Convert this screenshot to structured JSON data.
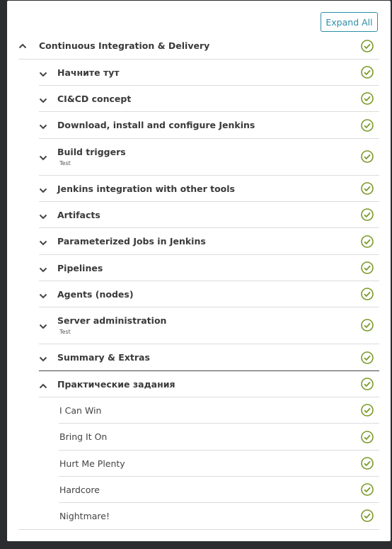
{
  "toolbar": {
    "expand_all_label": "Expand All"
  },
  "course": {
    "title": "Continuous Integration & Delivery",
    "sections": [
      {
        "title": "Начните тут",
        "subtitle": ""
      },
      {
        "title": "CI&CD concept",
        "subtitle": ""
      },
      {
        "title": "Download, install and configure Jenkins",
        "subtitle": ""
      },
      {
        "title": "Build triggers",
        "subtitle": "Test"
      },
      {
        "title": "Jenkins integration with other tools",
        "subtitle": ""
      },
      {
        "title": "Artifacts",
        "subtitle": ""
      },
      {
        "title": "Parameterized Jobs in Jenkins",
        "subtitle": ""
      },
      {
        "title": "Pipelines",
        "subtitle": ""
      },
      {
        "title": "Agents (nodes)",
        "subtitle": ""
      },
      {
        "title": "Server administration",
        "subtitle": "Test"
      },
      {
        "title": "Summary & Extras",
        "subtitle": ""
      },
      {
        "title": "Практические задания",
        "subtitle": ""
      }
    ],
    "lessons": [
      {
        "title": "I Can Win"
      },
      {
        "title": "Bring It On"
      },
      {
        "title": "Hurt Me Plenty"
      },
      {
        "title": "Hardcore"
      },
      {
        "title": "Nightmare!"
      }
    ]
  },
  "colors": {
    "accent": "#2b8fa6",
    "check": "#7a9a2a",
    "background": "#2b2d30"
  },
  "icons": {
    "collapse": "chevron-up-icon",
    "expand": "chevron-down-icon",
    "done": "check-circle-icon"
  }
}
